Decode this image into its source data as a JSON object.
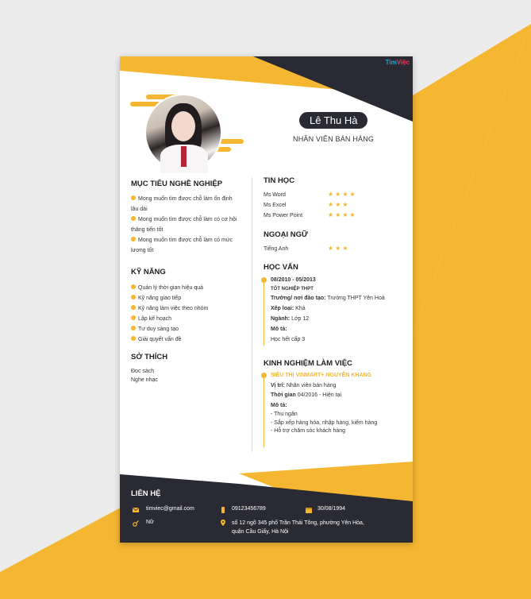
{
  "brand": {
    "name_a": "Tim",
    "name_b": "Việc"
  },
  "profile": {
    "name": "Lê Thu Hà",
    "role": "NHÂN VIÊN BÁN HÀNG"
  },
  "objective": {
    "title": "MỤC TIÊU NGHỀ NGHIỆP",
    "items": [
      {
        "line1": "Mong muốn tìm được chỗ làm ổn định",
        "line2": "lâu dài"
      },
      {
        "line1": "Mong muốn tìm được chỗ làm có cơ hội",
        "line2": "thăng tiến tốt"
      },
      {
        "line1": "Mong muốn tìm được chỗ làm có mức",
        "line2": "lương tốt"
      }
    ]
  },
  "skills": {
    "title": "KỸ NĂNG",
    "items": [
      "Quản lý thời gian hiệu quả",
      "Kỹ năng giao tiếp",
      "Kỹ năng làm việc theo nhóm",
      "Lập kế hoạch",
      "Tư duy sáng tạo",
      "Giải quyết vấn đề"
    ]
  },
  "hobbies": {
    "title": "SỞ THÍCH",
    "items": [
      "Đọc sách",
      "Nghe nhạc"
    ]
  },
  "it": {
    "title": "TIN HỌC",
    "items": [
      {
        "name": "Ms Word",
        "stars": "★★★★",
        "rating": 4
      },
      {
        "name": "Ms Excel",
        "stars": "★★★",
        "rating": 3
      },
      {
        "name": "Ms Power Point",
        "stars": "★★★★",
        "rating": 4
      }
    ]
  },
  "languages": {
    "title": "NGOẠI NGỮ",
    "items": [
      {
        "name": "Tiếng Anh",
        "stars": "★★★",
        "rating": 3
      }
    ]
  },
  "education": {
    "title": "HỌC VẤN",
    "period": "08/2010 - 05/2013",
    "degree": "TỐT NGHIỆP THPT",
    "school_label": "Trường/ nơi đào tạo:",
    "school": "Trường THPT Yên Hoà",
    "rank_label": "Xếp loại:",
    "rank": "Khá",
    "major_label": "Ngành:",
    "major": "Lớp 12",
    "desc_label": "Mô tả:",
    "desc": "Học hết cấp 3"
  },
  "experience": {
    "title": "KINH NGHIỆM LÀM VIỆC",
    "company": "SIÊU THỊ VINMART+ NGUYỄN KHANG",
    "position_label": "Vị trí:",
    "position": "Nhân viên bán hàng",
    "time_label": "Thời gian",
    "time": "04/2016 - Hiện tại",
    "desc_label": "Mô tả:",
    "tasks": [
      "- Thu ngân",
      "- Sắp xếp hàng hóa, nhập hàng, kiểm hàng",
      "- Hỗ trợ chăm sóc khách hàng"
    ]
  },
  "contact": {
    "title": "LIÊN HỆ",
    "email": "timviec@gmail.com",
    "phone": "09123456789",
    "dob": "30/08/1994",
    "gender": "Nữ",
    "address_line1": "số 12 ngõ 345 phố Trần Thái Tông, phường Yên Hòa,",
    "address_line2": "quận Cầu Giấy, Hà Nội"
  },
  "colors": {
    "accent": "#f5b731",
    "dark": "#2a2a35",
    "background": "#ececec"
  }
}
